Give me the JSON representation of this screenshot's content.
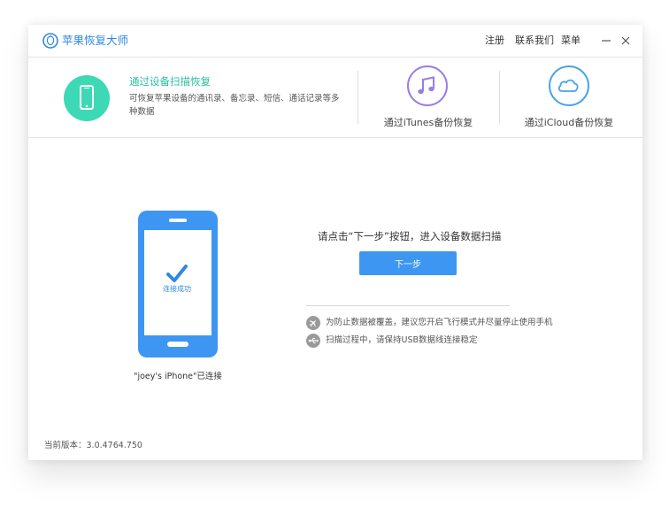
{
  "app": {
    "title": "苹果恢复大师"
  },
  "menu": {
    "register": "注册",
    "contact": "联系我们",
    "menu": "菜单"
  },
  "modes": {
    "device_scan": {
      "title": "通过设备扫描恢复",
      "description": "可恢复苹果设备的通讯录、备忘录、短信、通话记录等多种数据"
    },
    "itunes": {
      "label": "通过iTunes备份恢复"
    },
    "icloud": {
      "label": "通过iCloud备份恢复"
    }
  },
  "device": {
    "status": "连接成功",
    "caption": "\"joey's iPhone\"已连接"
  },
  "main": {
    "prompt": "请点击“下一步”按钮，进入设备数据扫描",
    "next_label": "下一步"
  },
  "tips": [
    {
      "icon": "airplane-icon",
      "text": "为防止数据被覆盖，建议您开启飞行模式并尽量停止使用手机"
    },
    {
      "icon": "usb-icon",
      "text": "扫描过程中，请保持USB数据线连接稳定"
    }
  ],
  "footer": {
    "version": "当前版本：3.0.4764.750"
  },
  "colors": {
    "brand_blue": "#2f89e0",
    "button_blue": "#3d97f2",
    "teal": "#3dd9b6",
    "itunes_purple": "#9a7ee6",
    "icloud_blue": "#4aa3ea"
  }
}
